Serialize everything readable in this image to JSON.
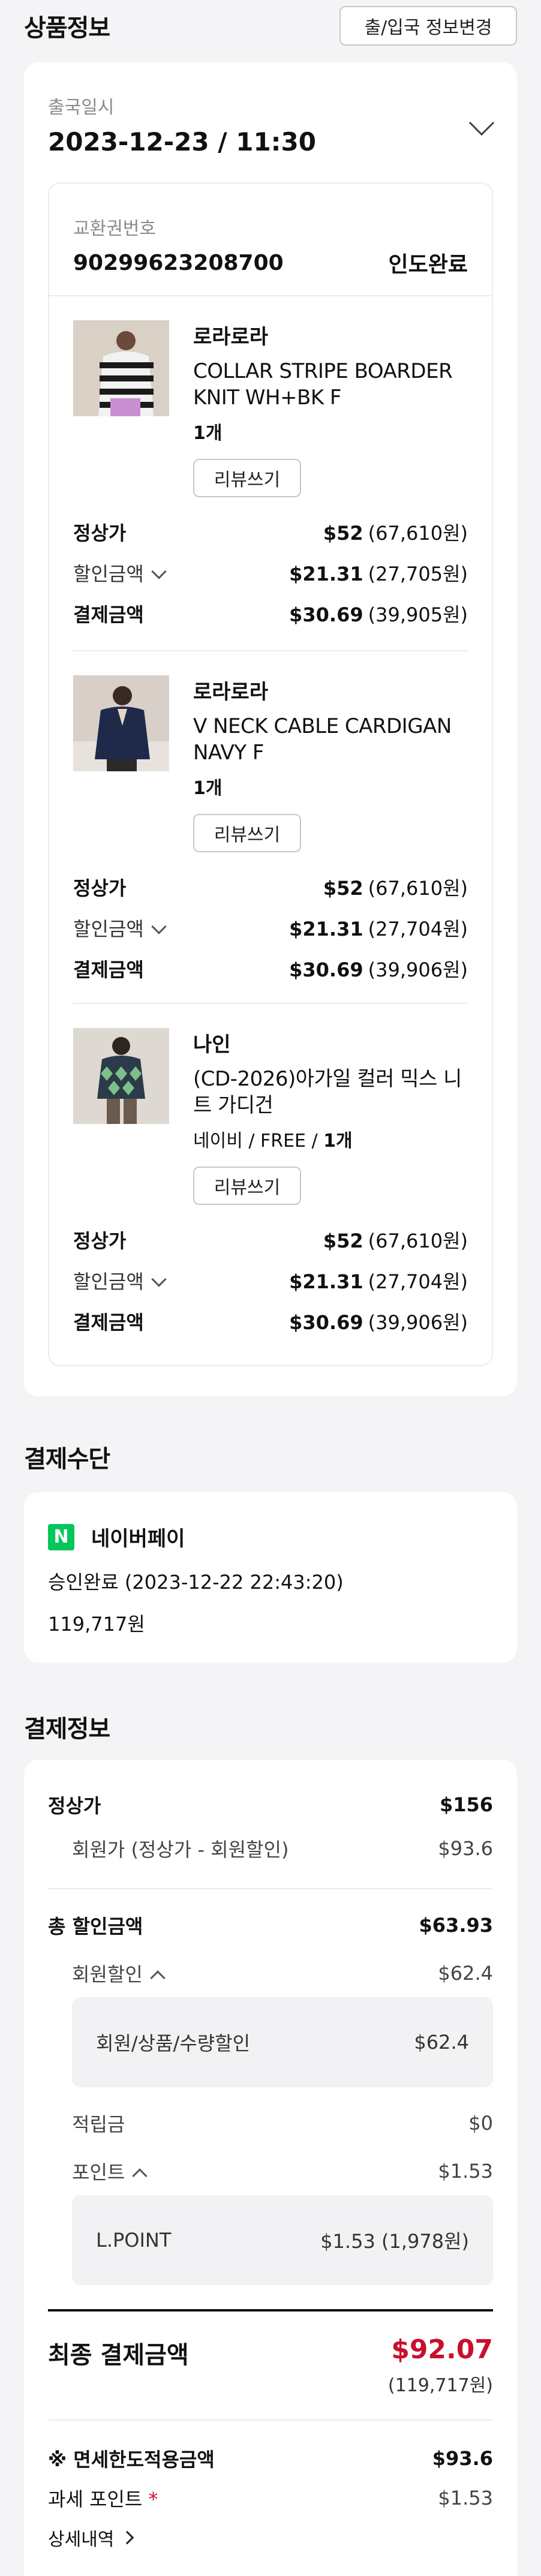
{
  "header": {
    "title": "상품정보",
    "change_button": "출/입국 정보변경"
  },
  "departure": {
    "label": "출국일시",
    "datetime": "2023-12-23 / 11:30"
  },
  "voucher": {
    "label": "교환권번호",
    "number": "90299623208700",
    "status": "인도완료"
  },
  "items": [
    {
      "brand": "로라로라",
      "name": "COLLAR STRIPE BOARDER KNIT WH+BK F",
      "qty": "1개",
      "option": "",
      "review_button": "리뷰쓰기",
      "regular_label": "정상가",
      "regular_usd": "$52",
      "regular_krw": "(67,610원)",
      "discount_label": "할인금액",
      "discount_usd": "$21.31",
      "discount_krw": "(27,705원)",
      "pay_label": "결제금액",
      "pay_usd": "$30.69",
      "pay_krw": "(39,905원)"
    },
    {
      "brand": "로라로라",
      "name": "V NECK CABLE CARDIGAN NAVY F",
      "qty": "1개",
      "option": "",
      "review_button": "리뷰쓰기",
      "regular_label": "정상가",
      "regular_usd": "$52",
      "regular_krw": "(67,610원)",
      "discount_label": "할인금액",
      "discount_usd": "$21.31",
      "discount_krw": "(27,704원)",
      "pay_label": "결제금액",
      "pay_usd": "$30.69",
      "pay_krw": "(39,906원)"
    },
    {
      "brand": "나인",
      "name": "(CD-2026)아가일 컬러 믹스 니트 가디건",
      "qty": "1개",
      "option": "네이비 / FREE / ",
      "review_button": "리뷰쓰기",
      "regular_label": "정상가",
      "regular_usd": "$52",
      "regular_krw": "(67,610원)",
      "discount_label": "할인금액",
      "discount_usd": "$21.31",
      "discount_krw": "(27,704원)",
      "pay_label": "결제금액",
      "pay_usd": "$30.69",
      "pay_krw": "(39,906원)"
    }
  ],
  "payment_method": {
    "title": "결제수단",
    "logo_letter": "N",
    "name": "네이버페이",
    "approval": "승인완료 (2023-12-22 22:43:20)",
    "amount": "119,717원"
  },
  "payment_info": {
    "title": "결제정보",
    "regular_label": "정상가",
    "regular_value": "$156",
    "member_price_label": "회원가 (정상가 - 회원할인)",
    "member_price_value": "$93.6",
    "total_discount_label": "총 할인금액",
    "total_discount_value": "$63.93",
    "member_discount_label": "회원할인",
    "member_discount_value": "$62.4",
    "member_discount_detail_label": "회원/상품/수량할인",
    "member_discount_detail_value": "$62.4",
    "reserve_label": "적립금",
    "reserve_value": "$0",
    "point_label": "포인트",
    "point_value": "$1.53",
    "lpoint_label": "L.POINT",
    "lpoint_value": "$1.53 (1,978원)",
    "final_label": "최종 결제금액",
    "final_value": "$92.07",
    "final_krw": "(119,717원)",
    "dutyfree_label": "※ 면세한도적용금액",
    "dutyfree_value": "$93.6",
    "taxed_point_label": "과세 포인트",
    "taxed_point_star": "*",
    "taxed_point_value": "$1.53",
    "detail_link": "상세내역"
  },
  "colors": {
    "accent_red": "#c8102e",
    "naver_green": "#03c75a"
  }
}
